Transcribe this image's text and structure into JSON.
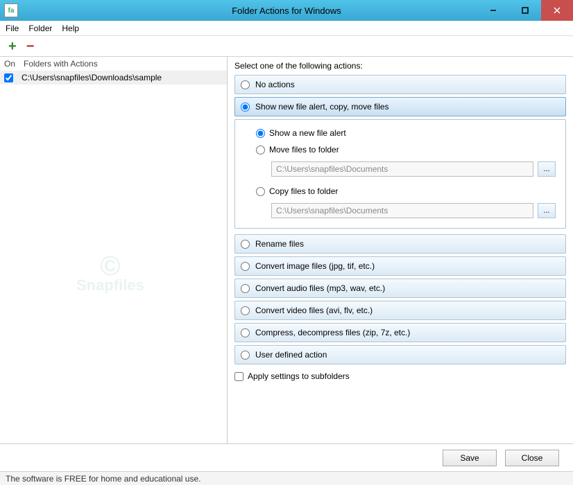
{
  "titlebar": {
    "app_icon_text": "fa",
    "title": "Folder Actions for Windows"
  },
  "menu": {
    "file": "File",
    "folder": "Folder",
    "help": "Help"
  },
  "left": {
    "col_on": "On",
    "col_folders": "Folders with Actions",
    "rows": [
      {
        "checked": true,
        "path": "C:\\Users\\snapfiles\\Downloads\\sample"
      }
    ]
  },
  "right": {
    "prompt": "Select one of the following actions:",
    "opts": {
      "none": "No actions",
      "show": "Show new file alert, copy, move files",
      "rename": "Rename files",
      "img": "Convert image files (jpg, tif, etc.)",
      "aud": "Convert audio files (mp3, wav, etc.)",
      "vid": "Convert video files (avi, flv, etc.)",
      "zip": "Compress, decompress files (zip, 7z, etc.)",
      "user": "User defined action"
    },
    "sub": {
      "alert": "Show a new file alert",
      "move": "Move files to folder",
      "copy": "Copy files to folder",
      "path1": "C:\\Users\\snapfiles\\Documents",
      "path2": "C:\\Users\\snapfiles\\Documents",
      "browse": "..."
    },
    "apply": "Apply settings to subfolders"
  },
  "footer": {
    "save": "Save",
    "close": "Close"
  },
  "status": "The software is FREE for home and educational use."
}
